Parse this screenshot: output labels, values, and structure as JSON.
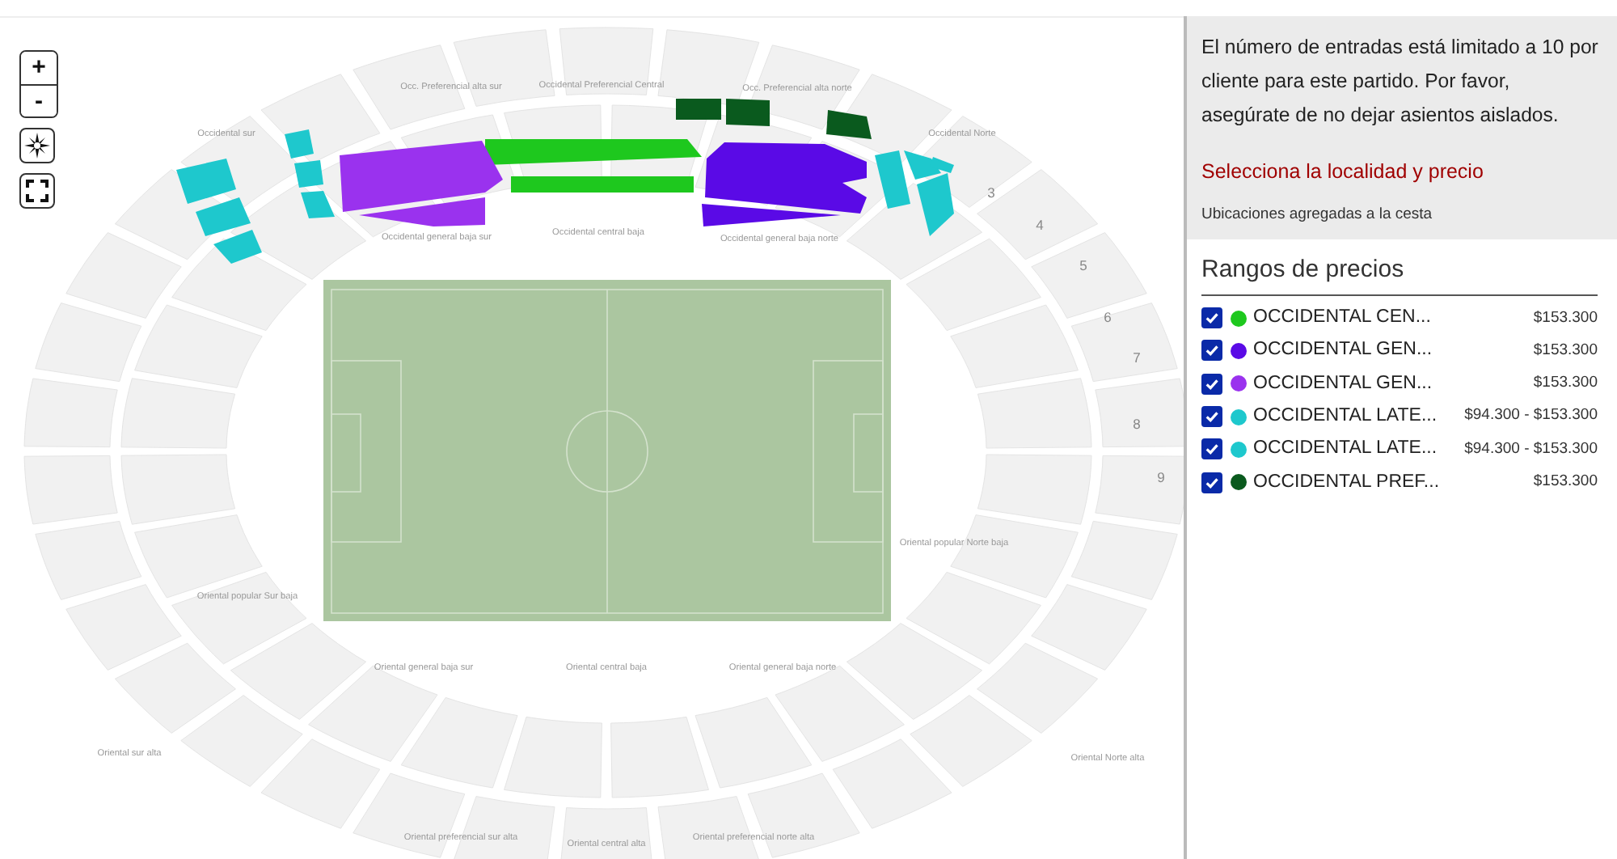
{
  "map_controls": [
    {
      "kind": "zoom_in",
      "label": "+"
    },
    {
      "kind": "zoom_out",
      "label": "-"
    },
    {
      "kind": "recenter"
    },
    {
      "kind": "fullscreen"
    }
  ],
  "map": {
    "section_labels": [
      "Occ. Preferencial alta sur",
      "Occidental Preferencial Central",
      "Occ. Preferencial alta norte",
      "Occidental sur",
      "Occidental Norte",
      "Occidental general baja sur",
      "Occidental central baja",
      "Occidental general baja norte",
      "3",
      "4",
      "5",
      "6",
      "7",
      "8",
      "9",
      "Oriental popular Norte baja",
      "Oriental popular Sur baja",
      "Oriental general baja sur",
      "Oriental central baja",
      "Oriental general baja norte",
      "Oriental sur alta",
      "Oriental Norte alta",
      "Oriental preferencial sur alta",
      "Oriental central alta",
      "Oriental preferencial norte alta"
    ]
  },
  "info": {
    "notice": "El número de entradas está limitado a 10 por cliente para este partido. Por favor, asegúrate de no dejar asientos aislados.",
    "prompt": "Selecciona la localidad y precio",
    "basket_note": "Ubicaciones agregadas a la cesta"
  },
  "price_ranges": {
    "title": "Rangos de precios",
    "items": [
      {
        "name": "OCCIDENTAL CEN...",
        "price": "$153.300",
        "color": "#1ec81e",
        "checked": true
      },
      {
        "name": "OCCIDENTAL GEN...",
        "price": "$153.300",
        "color": "#5a0ae6",
        "checked": true
      },
      {
        "name": "OCCIDENTAL GEN...",
        "price": "$153.300",
        "color": "#9a32ee",
        "checked": true
      },
      {
        "name": "OCCIDENTAL LATE...",
        "price": "$94.300 - $153.300",
        "color": "#1ec8cd",
        "checked": true
      },
      {
        "name": "OCCIDENTAL LATE...",
        "price": "$94.300 - $153.300",
        "color": "#1ec8cd",
        "checked": true
      },
      {
        "name": "OCCIDENTAL PREF...",
        "price": "$153.300",
        "color": "#0a5a1e",
        "checked": true
      }
    ]
  }
}
